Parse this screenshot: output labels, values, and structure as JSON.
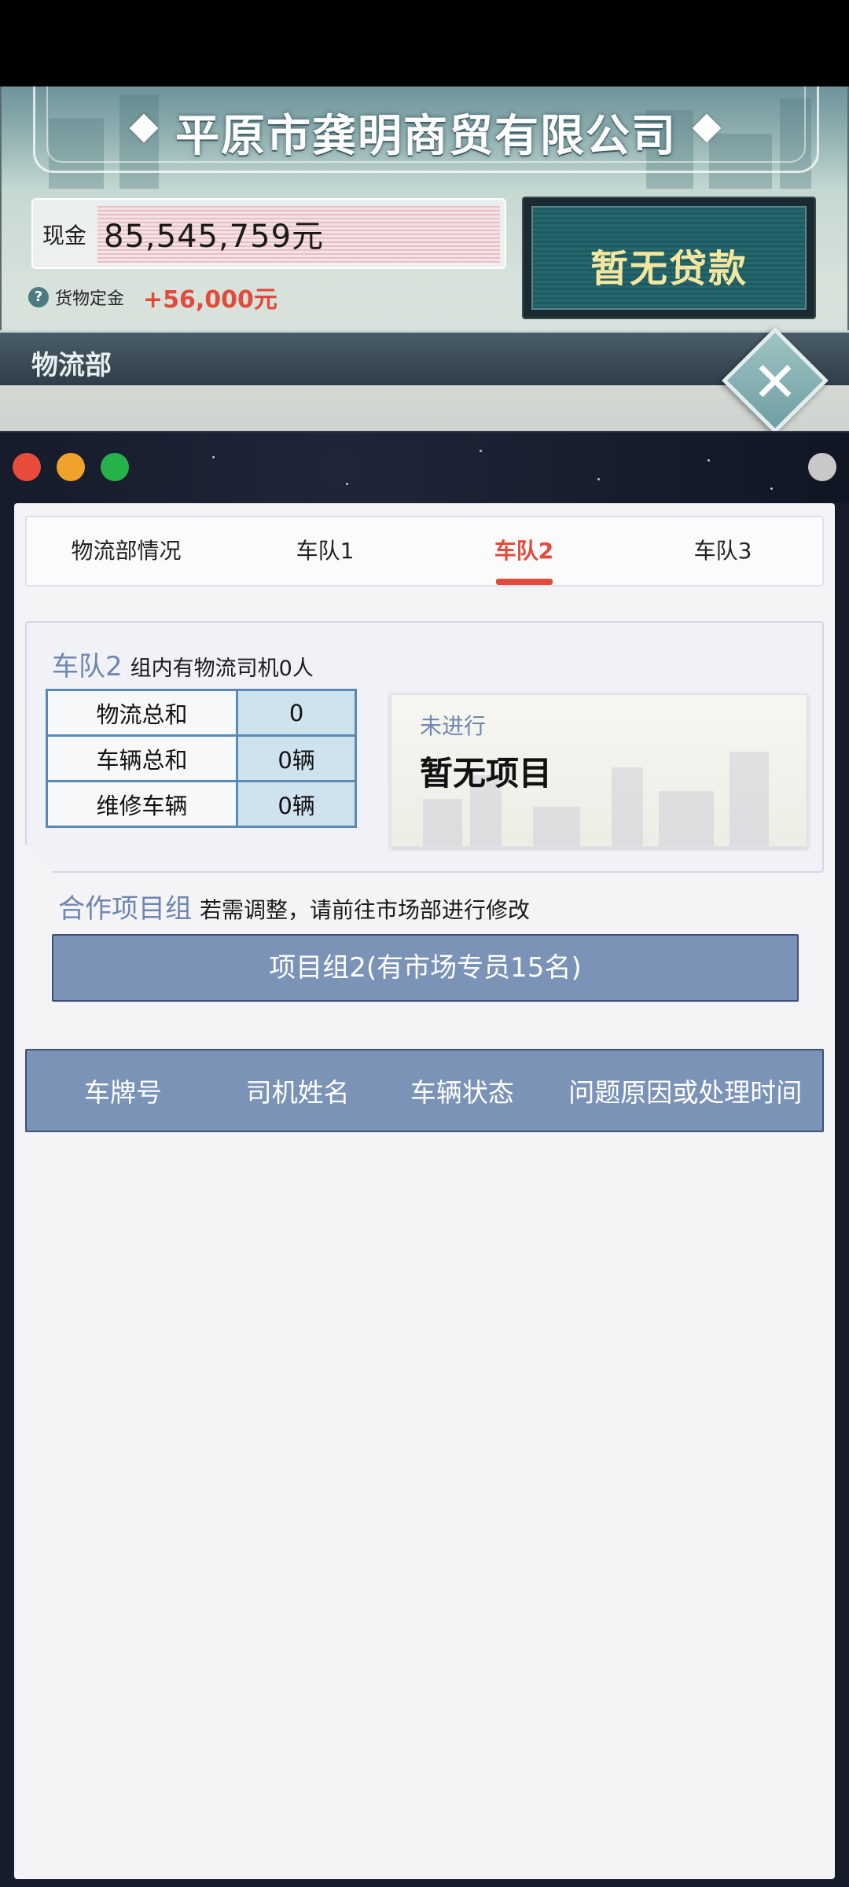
{
  "company": {
    "name": "平原市龚明商贸有限公司",
    "cash_label": "现金",
    "cash_value": "85,545,759元",
    "deposit_label": "货物定金",
    "deposit_value": "+56,000元",
    "loan_label": "暂无贷款",
    "help_glyph": "?"
  },
  "department": {
    "title": "物流部",
    "close_glyph": "✕"
  },
  "tabs": [
    {
      "label": "物流部情况",
      "active": false
    },
    {
      "label": "车队1",
      "active": false
    },
    {
      "label": "车队2",
      "active": true
    },
    {
      "label": "车队3",
      "active": false
    }
  ],
  "fleet": {
    "name": "车队2",
    "description": "组内有物流司机0人",
    "stats": [
      {
        "label": "物流总和",
        "value": "0"
      },
      {
        "label": "车辆总和",
        "value": "0辆"
      },
      {
        "label": "维修车辆",
        "value": "0辆"
      }
    ],
    "project_status": "未进行",
    "project_name": "暂无项目"
  },
  "cooperation": {
    "title": "合作项目组",
    "hint": "若需调整，请前往市场部进行修改",
    "group_label": "项目组2(有市场专员15名)"
  },
  "vehicle_table": {
    "headers": [
      "车牌号",
      "司机姓名",
      "车辆状态",
      "问题原因或处理时间"
    ],
    "rows": []
  },
  "colors": {
    "accent_red": "#e24a3b",
    "accent_blue": "#6e86b0",
    "header_blue": "#7b93b7",
    "loan_text": "#f3e7a0"
  }
}
